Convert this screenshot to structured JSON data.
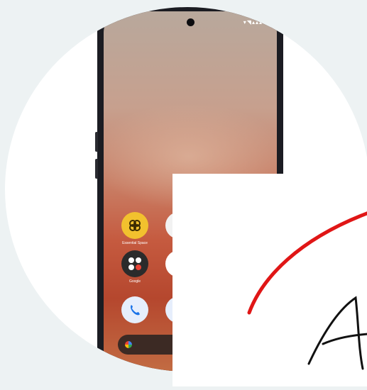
{
  "status": {
    "time": "",
    "icons": "▾◥▴▴▴"
  },
  "glance": {
    "line1": "",
    "line2": ""
  },
  "apps_row1": [
    {
      "label": "Essential Space",
      "color": "#f2c12e"
    },
    {
      "label": "",
      "color": "#e04a46"
    }
  ],
  "apps_row2": [
    {
      "label": "Google",
      "color": "#2b2b2b"
    },
    {
      "label": "",
      "color": "#ffffff"
    }
  ],
  "dock": [
    {
      "label": "",
      "color": "#e6eefc"
    },
    {
      "label": "",
      "color": "#e6eefc"
    }
  ],
  "colors": {
    "background": "#edf2f3",
    "accent": "#e01616",
    "ink": "#111111"
  },
  "overlay": {
    "visible_glyph": "A"
  }
}
